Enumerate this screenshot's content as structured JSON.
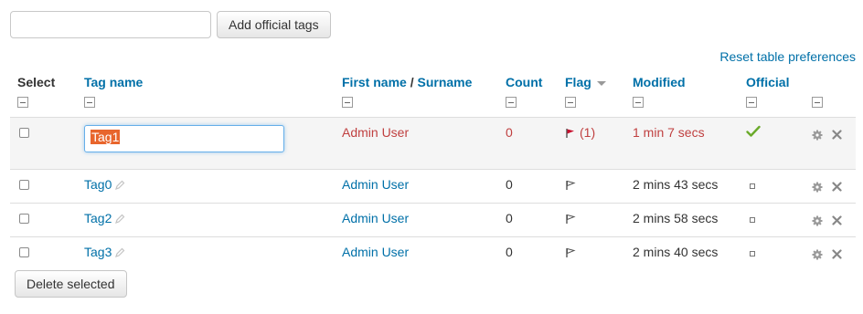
{
  "add_tags": {
    "input_value": "",
    "button_label": "Add official tags"
  },
  "reset_link": "Reset table preferences",
  "columns": {
    "select": "Select",
    "tag_name": "Tag name",
    "first_name": "First name",
    "separator": " / ",
    "surname": "Surname",
    "count": "Count",
    "flag": "Flag",
    "modified": "Modified",
    "official": "Official"
  },
  "rows": [
    {
      "tag": "Tag1",
      "user": "Admin User",
      "count": "0",
      "flag_count": "(1)",
      "modified": "1 min 7 secs",
      "official": true,
      "flagged": true,
      "editing": true
    },
    {
      "tag": "Tag0",
      "user": "Admin User",
      "count": "0",
      "flag_count": "",
      "modified": "2 mins 43 secs",
      "official": false,
      "flagged": false,
      "editing": false
    },
    {
      "tag": "Tag2",
      "user": "Admin User",
      "count": "0",
      "flag_count": "",
      "modified": "2 mins 58 secs",
      "official": false,
      "flagged": false,
      "editing": false
    },
    {
      "tag": "Tag3",
      "user": "Admin User",
      "count": "0",
      "flag_count": "",
      "modified": "2 mins 40 secs",
      "official": false,
      "flagged": false,
      "editing": false
    }
  ],
  "delete_selected_label": "Delete selected",
  "colors": {
    "link": "#0070a8",
    "flagged_text": "#c04040",
    "selection": "#e8652c",
    "check_green": "#6aaa2a"
  },
  "icons": [
    "collapse-icon",
    "sort-arrow-icon",
    "pencil-icon",
    "flag-icon",
    "check-icon",
    "gear-icon",
    "close-icon"
  ]
}
